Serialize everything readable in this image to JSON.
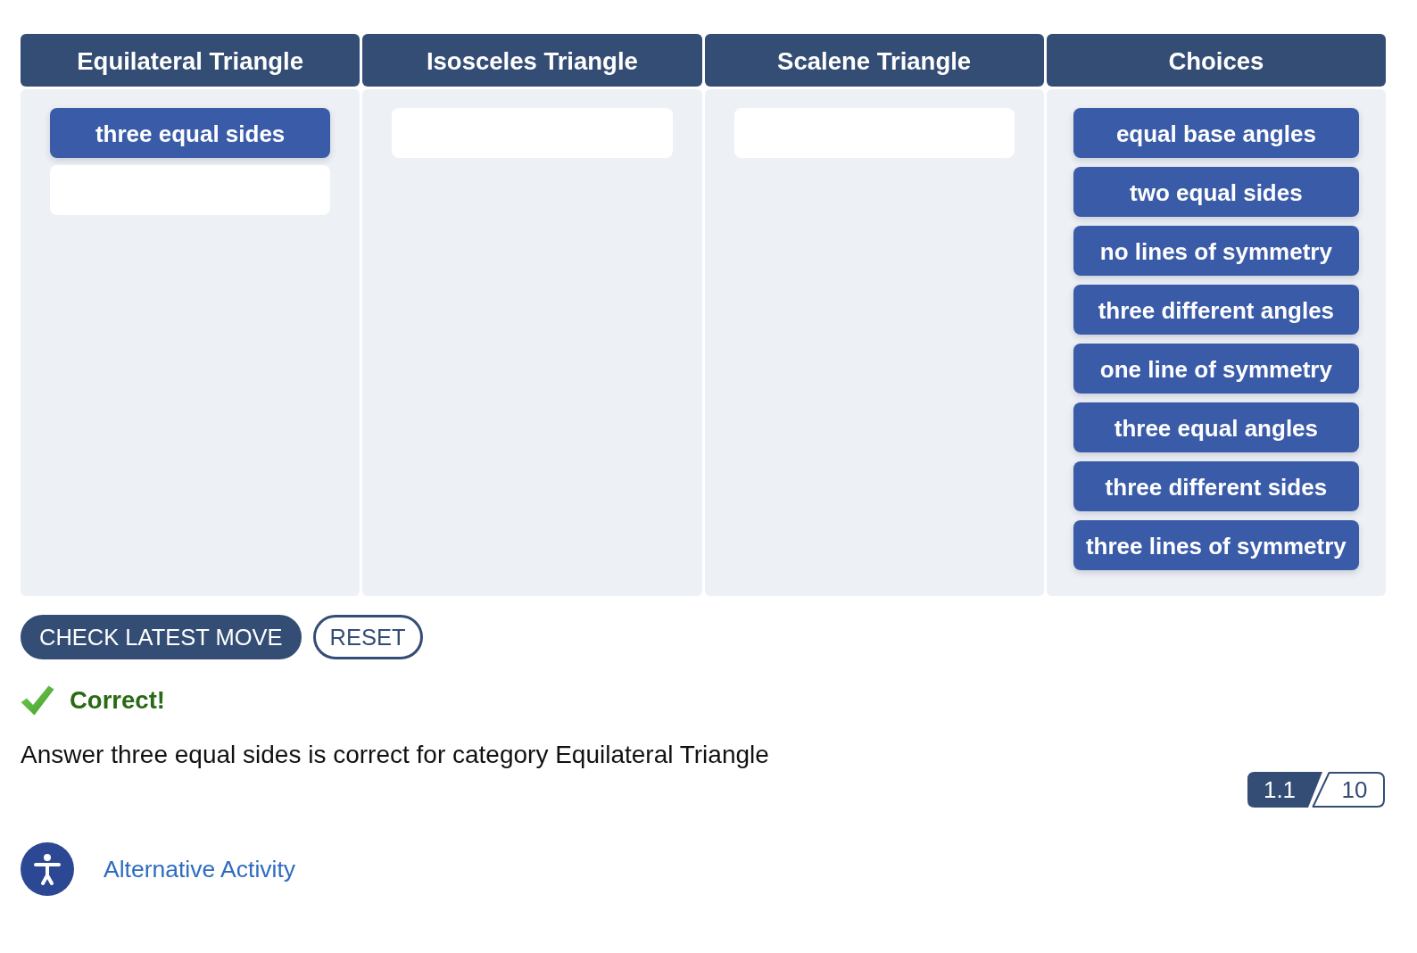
{
  "columns": [
    {
      "kind": "category",
      "title": "Equilateral Triangle",
      "items": [
        "three equal sides"
      ]
    },
    {
      "kind": "category",
      "title": "Isosceles Triangle"
    },
    {
      "kind": "category",
      "title": "Scalene Triangle"
    },
    {
      "kind": "choices",
      "title": "Choices",
      "items": [
        "equal base angles",
        "two equal sides",
        "no lines of symmetry",
        "three different angles",
        "one line of symmetry",
        "three equal angles",
        "three different sides",
        "three lines of symmetry"
      ]
    }
  ],
  "actions": [
    {
      "kind": "primary",
      "label": "CHECK LATEST MOVE"
    },
    {
      "kind": "outline",
      "label": "RESET"
    }
  ],
  "feedback": {
    "correct": true,
    "title": "Correct!",
    "message": "Answer three equal sides is correct for category Equilateral Triangle"
  },
  "progress": {
    "current": "1.1",
    "total": "10"
  },
  "alternative_activity": {
    "label": "Alternative Activity"
  }
}
